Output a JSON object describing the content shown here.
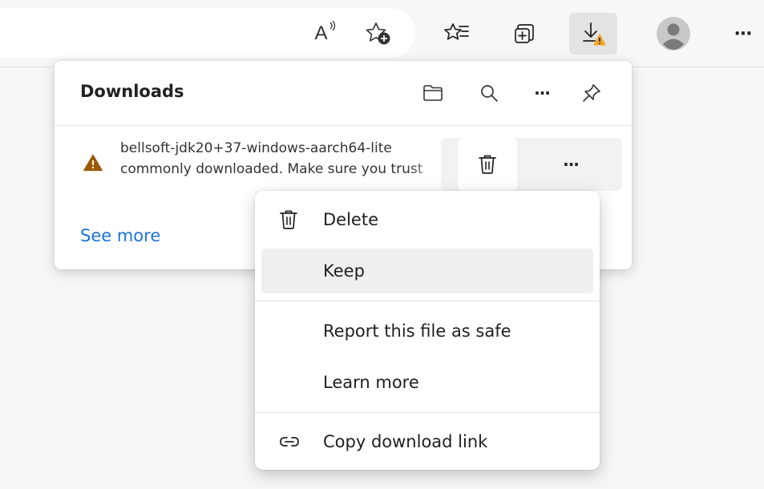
{
  "toolbar": {
    "buttons": [
      {
        "name": "read-aloud-icon",
        "label": "A"
      },
      {
        "name": "add-favorite-icon"
      },
      {
        "name": "favorites-icon"
      },
      {
        "name": "collections-icon"
      },
      {
        "name": "downloads-icon",
        "active": true,
        "badge_color": "#f5a623"
      },
      {
        "name": "profile-avatar-icon"
      },
      {
        "name": "more-icon",
        "label": "···"
      }
    ]
  },
  "downloads": {
    "title": "Downloads",
    "header_icons": [
      "folder-icon",
      "search-icon",
      "more-options-icon",
      "pin-icon"
    ],
    "more_label": "···",
    "item": {
      "line1": "bellsoft-jdk20+37-windows-aarch64-lite",
      "line2": "commonly downloaded. Make sure you trust",
      "warning_color": "#9a5a00",
      "more_label": "···"
    },
    "see_more": "See more"
  },
  "context_menu": {
    "items": [
      {
        "label": "Delete",
        "icon": "trash-icon"
      },
      {
        "label": "Keep",
        "hover": true
      },
      {
        "label": "Report this file as safe"
      },
      {
        "label": "Learn more"
      },
      {
        "label": "Copy download link",
        "icon": "link-icon"
      }
    ]
  },
  "colors": {
    "accent_link": "#1a73d9",
    "toolbar_bg": "#f7f7f7",
    "active_button_bg": "#e3e3e3"
  }
}
